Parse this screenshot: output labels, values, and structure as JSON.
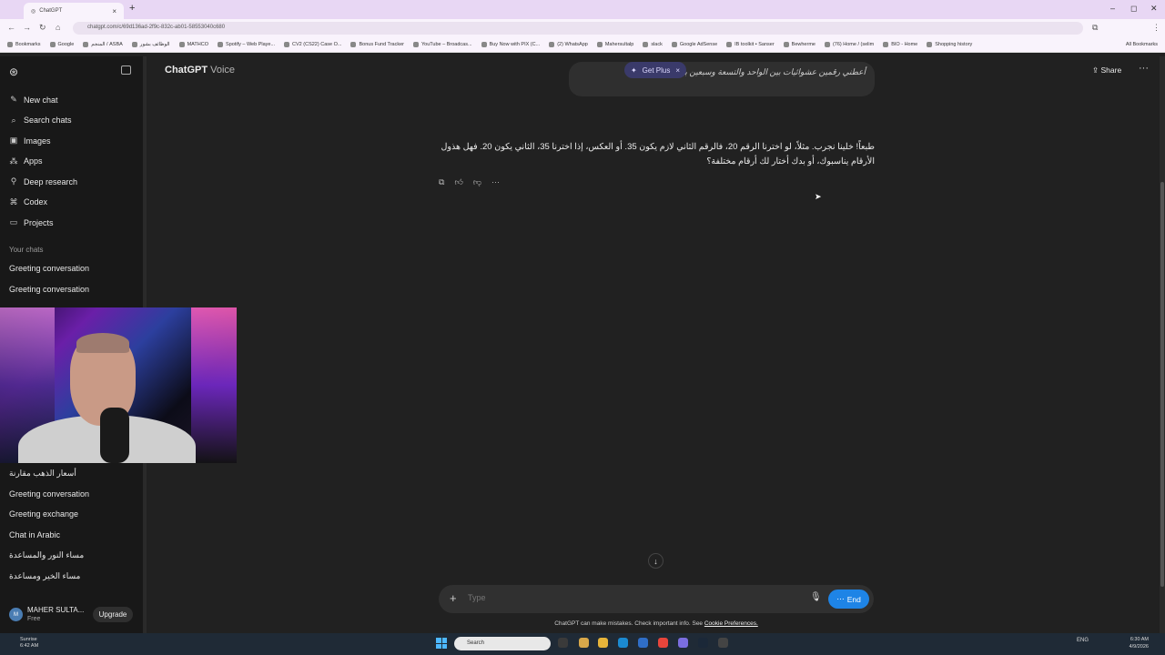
{
  "browser": {
    "tab_title": "ChatGPT",
    "url": "chatgpt.com/c/69d136ad-2f9c-832c-ab01-58553040c680",
    "bookmarks": [
      "Bookmarks",
      "Google",
      "المنجم / ASBA",
      "الوظائف بشور",
      "MATHCO",
      "Spotify – Web Playe...",
      "CV2 (CS22) Case O...",
      "Bonus Fund Tracker",
      "YouTube – Broadcas...",
      "Buy Now with PIX (C...",
      "(2) WhatsApp",
      "Mahersultalp",
      "slack",
      "Google AdSense",
      "IB toolkit • Sanser",
      "Bewherme",
      "(76) Home / (selim",
      "BIO - Home",
      "Shopping history"
    ],
    "all_bookmarks": "All Bookmarks"
  },
  "sidebar": {
    "nav": [
      {
        "label": "New chat",
        "icon": "edit-icon"
      },
      {
        "label": "Search chats",
        "icon": "search-icon"
      },
      {
        "label": "Images",
        "icon": "image-icon"
      },
      {
        "label": "Apps",
        "icon": "apps-icon"
      },
      {
        "label": "Deep research",
        "icon": "research-icon"
      },
      {
        "label": "Codex",
        "icon": "codex-icon"
      },
      {
        "label": "Projects",
        "icon": "folder-icon"
      }
    ],
    "your_chats_heading": "Your chats",
    "chats_top": [
      "Greeting conversation",
      "Greeting conversation"
    ],
    "chats_bottom": [
      "أسعار الذهب مقارنة",
      "Greeting conversation",
      "Greeting exchange",
      "Chat in Arabic",
      "مساء النور والمساعدة",
      "مساء الخير ومساعدة"
    ],
    "user": {
      "name": "MAHER SULTA...",
      "plan": "Free",
      "upgrade": "Upgrade"
    }
  },
  "header": {
    "title": "ChatGPT",
    "title_suffix": "Voice",
    "get_plus": "Get Plus",
    "share": "Share"
  },
  "conversation": {
    "user_message": "أعطني رقمين عشوائيات بين الواحد والتسعة وسبعين بينهم خمسين.",
    "assistant_message": "طبعاً! خلينا نجرب. مثلاً، لو اخترنا الرقم 20، فالرقم الثاني لازم يكون 35. أو العكس، إذا اخترنا 35، الثاني يكون 20. فهل هذول الأرقام يناسبوك، أو بدك أختار لك أرقام مختلفة؟"
  },
  "composer": {
    "placeholder": "Type",
    "end_label": "End",
    "disclaimer": "ChatGPT can make mistakes. Check important info. See",
    "cookie_link": "Cookie Preferences."
  },
  "taskbar": {
    "weather_title": "Sunrise",
    "weather_time": "6:42 AM",
    "search": "Search",
    "lang": "ENG",
    "time": "6:30 AM",
    "date": "4/9/2026"
  },
  "colors": {
    "accent": "#1e84e6",
    "background": "#212121",
    "sidebar": "#181818"
  }
}
